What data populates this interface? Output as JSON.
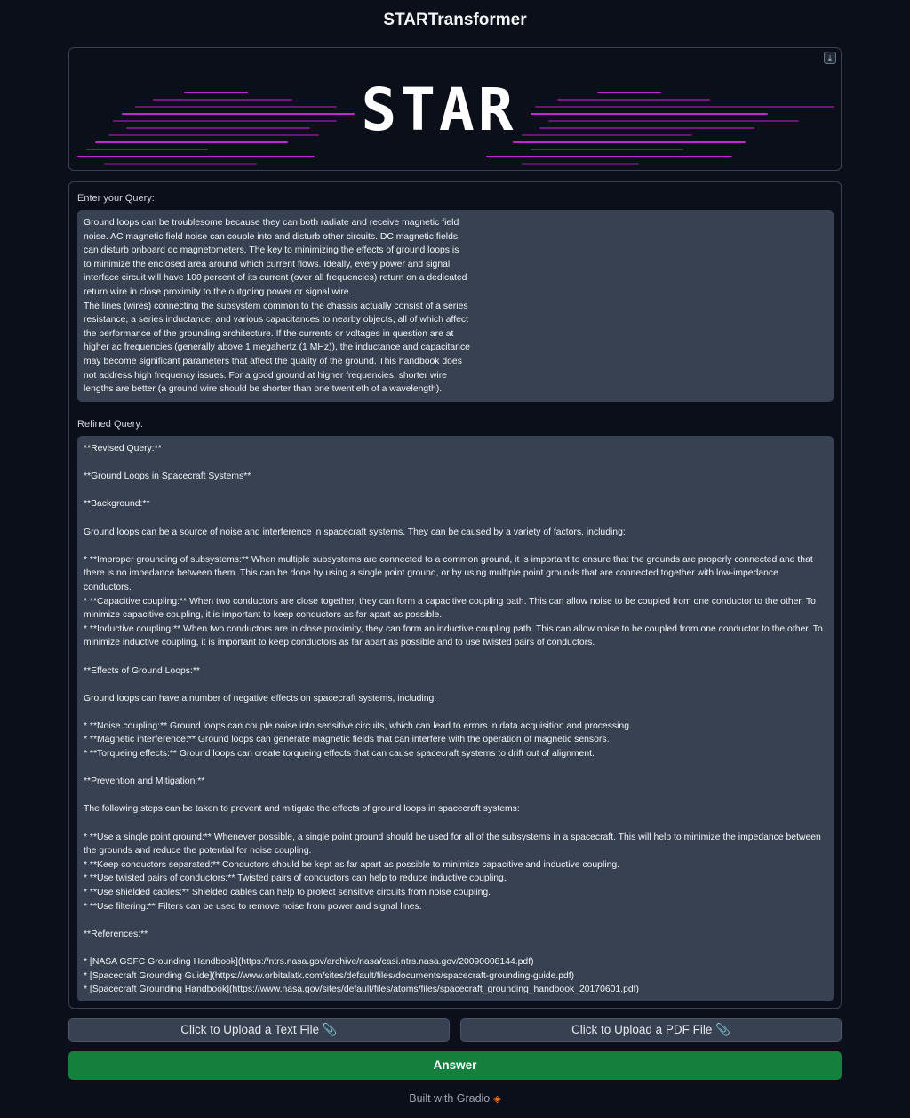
{
  "app": {
    "title": "STARTransformer"
  },
  "banner": {
    "logo_text": "STAR",
    "download_icon": "download-icon",
    "accent_color": "#c026d3"
  },
  "query": {
    "label": "Enter your Query:",
    "value": "Ground loops can be troublesome because they can both radiate and receive magnetic field\nnoise. AC magnetic field noise can couple into and disturb other circuits. DC magnetic fields\ncan disturb onboard dc magnetometers. The key to minimizing the effects of ground loops is\nto minimize the enclosed area around which current flows. Ideally, every power and signal\ninterface circuit will have 100 percent of its current (over all frequencies) return on a dedicated\nreturn wire in close proximity to the outgoing power or signal wire.\nThe lines (wires) connecting the subsystem common to the chassis actually consist of a series\nresistance, a series inductance, and various capacitances to nearby objects, all of which affect\nthe performance of the grounding architecture. If the currents or voltages in question are at\nhigher ac frequencies (generally above 1 megahertz (1 MHz)), the inductance and capacitance\nmay become significant parameters that affect the quality of the ground. This handbook does\nnot address high frequency issues. For a good ground at higher frequencies, shorter wire\nlengths are better (a ground wire should be shorter than one twentieth of a wavelength)."
  },
  "refined": {
    "label": "Refined Query:",
    "value": "**Revised Query:**\n\n**Ground Loops in Spacecraft Systems**\n\n**Background:**\n\nGround loops can be a source of noise and interference in spacecraft systems. They can be caused by a variety of factors, including:\n\n* **Improper grounding of subsystems:** When multiple subsystems are connected to a common ground, it is important to ensure that the grounds are properly connected and that there is no impedance between them. This can be done by using a single point ground, or by using multiple point grounds that are connected together with low-impedance conductors.\n* **Capacitive coupling:** When two conductors are close together, they can form a capacitive coupling path. This can allow noise to be coupled from one conductor to the other. To minimize capacitive coupling, it is important to keep conductors as far apart as possible.\n* **Inductive coupling:** When two conductors are in close proximity, they can form an inductive coupling path. This can allow noise to be coupled from one conductor to the other. To minimize inductive coupling, it is important to keep conductors as far apart as possible and to use twisted pairs of conductors.\n\n**Effects of Ground Loops:**\n\nGround loops can have a number of negative effects on spacecraft systems, including:\n\n* **Noise coupling:** Ground loops can couple noise into sensitive circuits, which can lead to errors in data acquisition and processing.\n* **Magnetic interference:** Ground loops can generate magnetic fields that can interfere with the operation of magnetic sensors.\n* **Torqueing effects:** Ground loops can create torqueing effects that can cause spacecraft systems to drift out of alignment.\n\n**Prevention and Mitigation:**\n\nThe following steps can be taken to prevent and mitigate the effects of ground loops in spacecraft systems:\n\n* **Use a single point ground:** Whenever possible, a single point ground should be used for all of the subsystems in a spacecraft. This will help to minimize the impedance between the grounds and reduce the potential for noise coupling.\n* **Keep conductors separated:** Conductors should be kept as far apart as possible to minimize capacitive and inductive coupling.\n* **Use twisted pairs of conductors:** Twisted pairs of conductors can help to reduce inductive coupling.\n* **Use shielded cables:** Shielded cables can help to protect sensitive circuits from noise coupling.\n* **Use filtering:** Filters can be used to remove noise from power and signal lines.\n\n**References:**\n\n* [NASA GSFC Grounding Handbook](https://ntrs.nasa.gov/archive/nasa/casi.ntrs.nasa.gov/20090008144.pdf)\n* [Spacecraft Grounding Guide](https://www.orbitalatk.com/sites/default/files/documents/spacecraft-grounding-guide.pdf)\n* [Spacecraft Grounding Handbook](https://www.nasa.gov/sites/default/files/atoms/files/spacecraft_grounding_handbook_20170601.pdf)"
  },
  "buttons": {
    "upload_text": "Click to Upload a Text File 📎",
    "upload_pdf": "Click to Upload a PDF File 📎",
    "answer": "Answer"
  },
  "footer": {
    "text": "Built with Gradio",
    "logo_icon": "gradio-logo-icon"
  }
}
